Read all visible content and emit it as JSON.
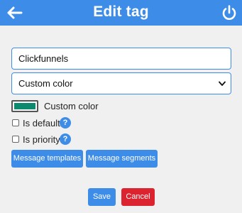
{
  "header": {
    "title": "Edit tag",
    "back_icon": "arrow-left-icon",
    "power_icon": "power-icon",
    "background": "#3d8ce8"
  },
  "form": {
    "name_value": "Clickfunnels",
    "color_mode_selected": "Custom color",
    "color_label": "Custom color",
    "color_value": "#0d8a6e",
    "is_default_label": "Is default",
    "is_default_checked": false,
    "is_priority_label": "Is priority",
    "is_priority_checked": false,
    "help_glyph": "?"
  },
  "actions": {
    "message_templates_label": "Message templates",
    "message_segments_label": "Message segments",
    "save_label": "Save",
    "cancel_label": "Cancel"
  },
  "colors": {
    "primary": "#3d8ce8",
    "danger": "#dc2430",
    "background": "#f0f0f0"
  }
}
